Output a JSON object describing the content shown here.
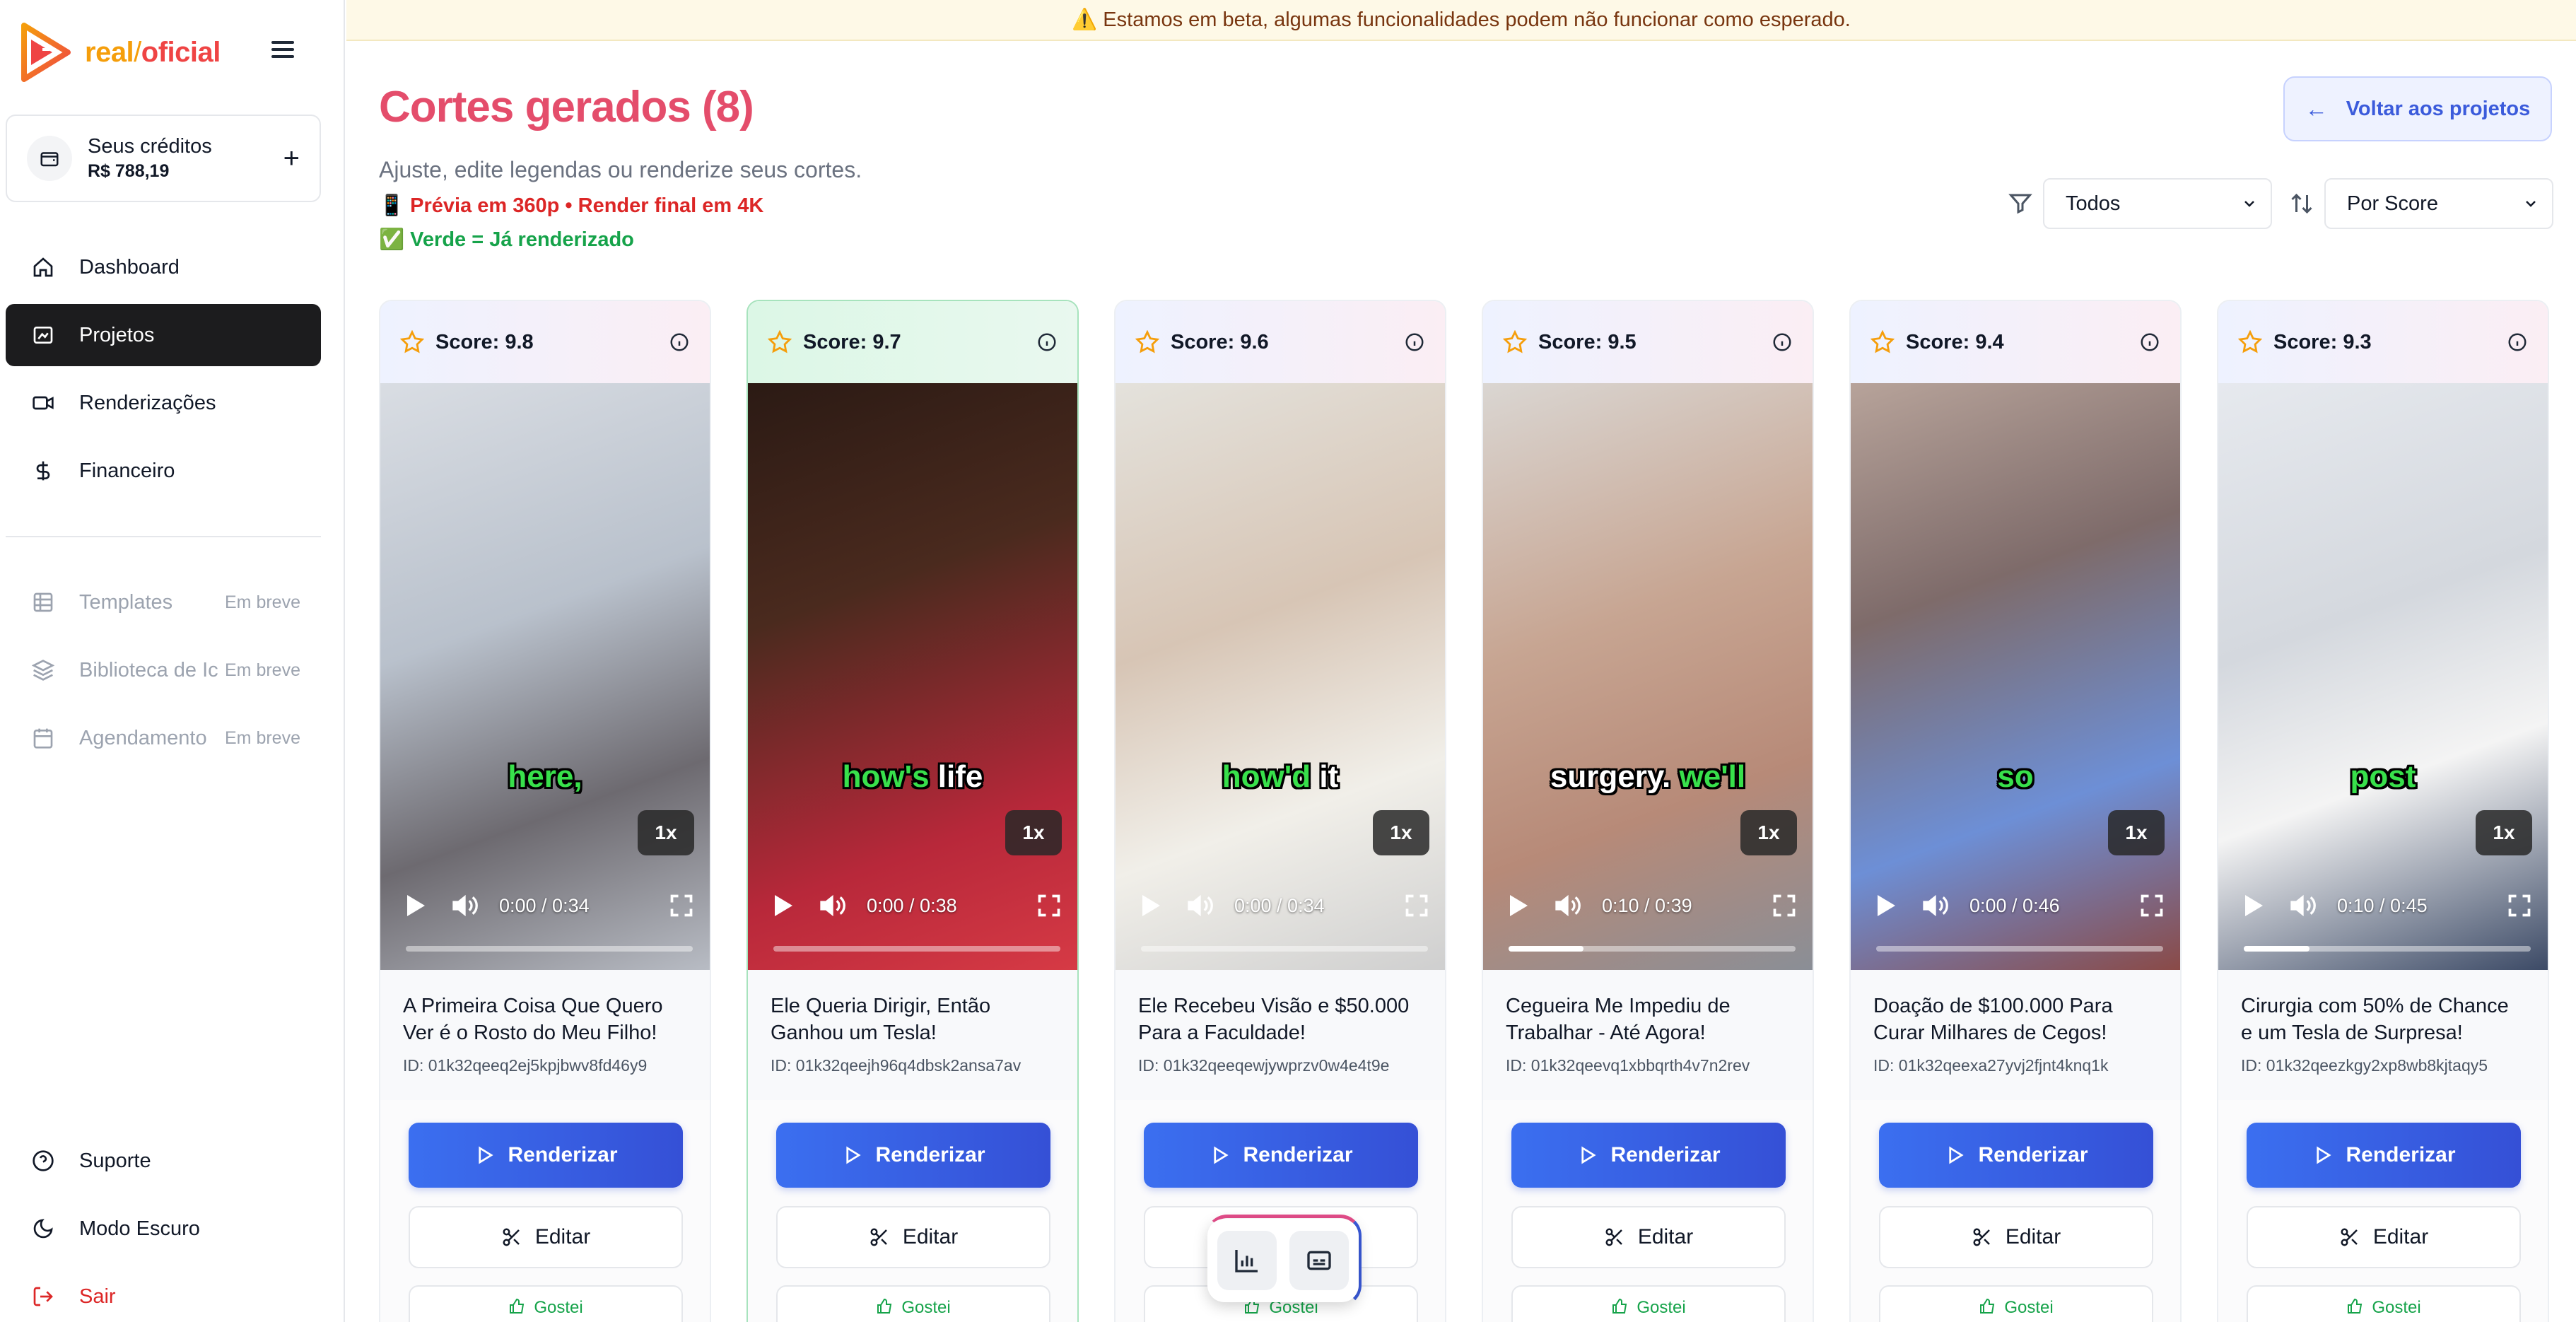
{
  "app": {
    "logo_part1": "real",
    "logo_sep": "/",
    "logo_part2": "oficial"
  },
  "credits": {
    "label": "Seus créditos",
    "value": "R$ 788,19",
    "add": "+"
  },
  "nav": {
    "main": [
      {
        "label": "Dashboard",
        "icon": "home-icon"
      },
      {
        "label": "Projetos",
        "icon": "projects-icon",
        "active": true
      },
      {
        "label": "Renderizações",
        "icon": "video-icon"
      },
      {
        "label": "Financeiro",
        "icon": "dollar-icon"
      }
    ],
    "soon": [
      {
        "label": "Templates",
        "badge": "Em breve",
        "icon": "grid-icon"
      },
      {
        "label": "Biblioteca de Ic",
        "badge": "Em breve",
        "icon": "layers-icon"
      },
      {
        "label": "Agendamento",
        "badge": "Em breve",
        "icon": "calendar-icon"
      }
    ],
    "bottom": [
      {
        "label": "Suporte",
        "icon": "help-icon"
      },
      {
        "label": "Modo Escuro",
        "icon": "moon-icon"
      },
      {
        "label": "Sair",
        "icon": "logout-icon"
      }
    ]
  },
  "banner": "⚠️ Estamos em beta, algumas funcionalidades podem não funcionar como esperado.",
  "header": {
    "title": "Cortes gerados (8)",
    "subtitle": "Ajuste, edite legendas ou renderize seus cortes.",
    "note_preview": "📱 Prévia em 360p • Render final em 4K",
    "note_rendered": "✅ Verde = Já renderizado",
    "back_label": "Voltar aos projetos"
  },
  "filters": {
    "filter_value": "Todos",
    "sort_value": "Por Score"
  },
  "card_labels": {
    "render": "Renderizar",
    "edit": "Editar",
    "like": "Gostei",
    "speed": "1x"
  },
  "cards": [
    {
      "score": "Score: 9.8",
      "caption_hl": "here,",
      "caption_rest": "",
      "hl_first": true,
      "time": "0:00 / 0:34",
      "progress": 0,
      "title": "A Primeira Coisa Que Quero Ver é o Rosto do Meu Filho!",
      "id": "ID: 01k32qeeq2ej5kpjbwv8fd46y9",
      "rendered": false
    },
    {
      "score": "Score: 9.7",
      "caption_hl": "how's",
      "caption_rest": " life",
      "hl_first": true,
      "time": "0:00 / 0:38",
      "progress": 0,
      "title": "Ele Queria Dirigir, Então Ganhou um Tesla!",
      "id": "ID: 01k32qeejh96q4dbsk2ansa7av",
      "rendered": true
    },
    {
      "score": "Score: 9.6",
      "caption_hl": "how'd",
      "caption_rest": " it",
      "hl_first": true,
      "time": "0:00 / 0:34",
      "progress": 0,
      "title": "Ele Recebeu Visão e $50.000 Para a Faculdade!",
      "id": "ID: 01k32qeeqewjywprzv0w4e4t9e",
      "rendered": false
    },
    {
      "score": "Score: 9.5",
      "caption_pre": "surgery. ",
      "caption_hl": "we'll",
      "caption_rest": "",
      "hl_first": false,
      "time": "0:10 / 0:39",
      "progress": 0.26,
      "title": "Cegueira Me Impediu de Trabalhar - Até Agora!",
      "id": "ID: 01k32qeevq1xbbqrth4v7n2rev",
      "rendered": false
    },
    {
      "score": "Score: 9.4",
      "caption_hl": "so",
      "caption_rest": "",
      "hl_first": true,
      "time": "0:00 / 0:46",
      "progress": 0,
      "title": "Doação de $100.000 Para Curar Milhares de Cegos!",
      "id": "ID: 01k32qeexa27yvj2fjnt4knq1k",
      "rendered": false
    },
    {
      "score": "Score: 9.3",
      "caption_hl": "post",
      "caption_rest": "",
      "hl_first": true,
      "time": "0:10 / 0:45",
      "progress": 0.23,
      "title": "Cirurgia com 50% de Chance e um Tesla de Surpresa!",
      "id": "ID: 01k32qeezkgy2xp8wb8kjtaqy5",
      "rendered": false
    }
  ],
  "floating_toolbar": {
    "items": [
      "chart-icon",
      "captions-icon"
    ]
  }
}
